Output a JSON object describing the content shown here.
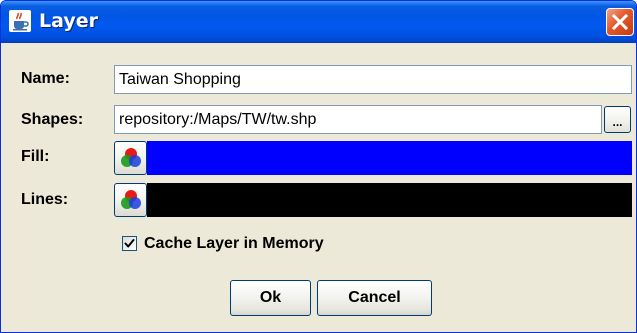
{
  "window": {
    "title": "Layer",
    "app_icon": "java-cup-icon",
    "close_icon": "close-icon"
  },
  "form": {
    "name_label": "Name:",
    "name_value": "Taiwan Shopping",
    "shapes_label": "Shapes:",
    "shapes_value": "repository:/Maps/TW/tw.shp",
    "browse_label": "...",
    "fill_label": "Fill:",
    "fill_color": "#0000ff",
    "lines_label": "Lines:",
    "lines_color": "#000000",
    "color_picker_icon": "rgb-circles-icon"
  },
  "options": {
    "cache_label": "Cache Layer in Memory",
    "cache_checked": true
  },
  "buttons": {
    "ok_label": "Ok",
    "cancel_label": "Cancel"
  },
  "colors": {
    "titlebar": "#0055e5",
    "dialog_bg": "#ece9d8",
    "close_button": "#e2572b"
  }
}
